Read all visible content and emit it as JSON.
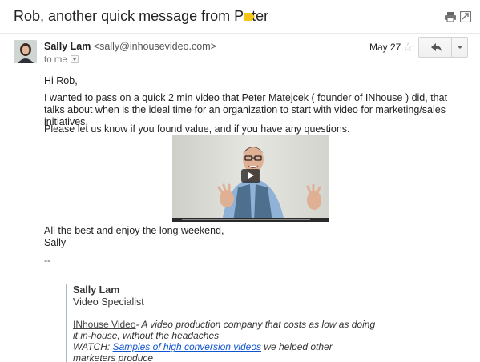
{
  "subject": "Rob, another quick message from Peter",
  "toolbar": {
    "print_icon": "print-icon",
    "popout_icon": "new-window-icon"
  },
  "message": {
    "sender_name": "Sally Lam",
    "sender_email": "<sally@inhousevideo.com>",
    "to_label": "to me",
    "date": "May 27",
    "greeting": "Hi Rob,",
    "para1": "I wanted to pass on a quick 2 min video that Peter Matejcek ( founder of INhouse ) did, that talks about when is the ideal time for an organization to start with video for marketing/sales initiatives.",
    "para2": "Please let us know if you found value, and if you have any questions.",
    "signoff_line1": "All the best and enjoy the long weekend,",
    "signoff_line2": "Sally",
    "separator": "--"
  },
  "signature": {
    "name": "Sally Lam",
    "title": "Video Specialist",
    "company": "INhouse Video",
    "tagline": "- A video production company that costs as low as doing it in-house, without the headaches",
    "watch_label": "WATCH: ",
    "watch_link": "Samples of high conversion videos",
    "watch_tail": " we helped other marketers produce"
  },
  "colors": {
    "label_tag": "#f5c518",
    "link": "#1155cc"
  }
}
